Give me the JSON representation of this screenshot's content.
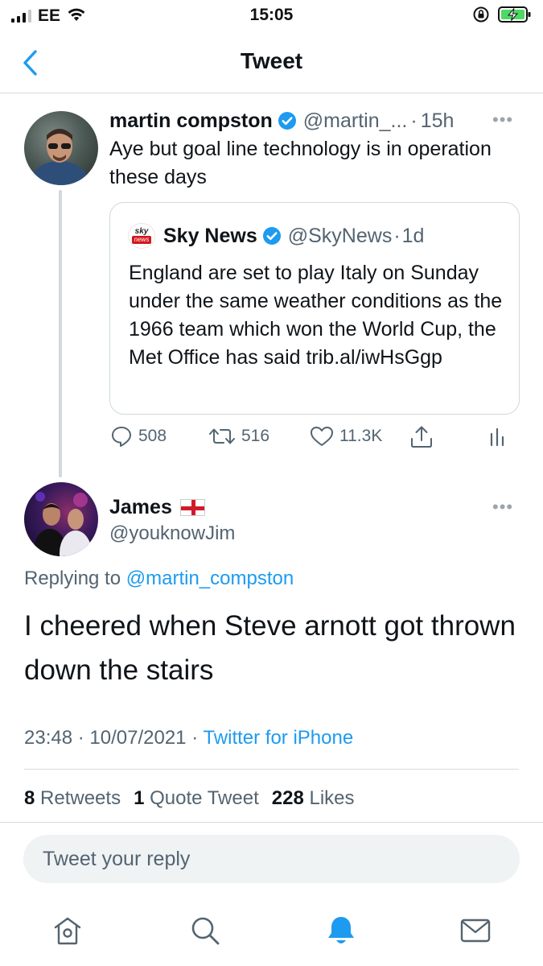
{
  "status_bar": {
    "carrier": "EE",
    "time": "15:05"
  },
  "header": {
    "title": "Tweet"
  },
  "parent_tweet": {
    "name": "martin compston",
    "handle": "@martin_...",
    "separator": "·",
    "time": "15h",
    "text": "Aye but goal line technology is in operation these days",
    "quoted": {
      "name": "Sky News",
      "handle": "@SkyNews",
      "separator": "·",
      "time": "1d",
      "logo_top": "sky",
      "logo_bottom": "news",
      "text": "England are set to play Italy on Sunday under the same weather conditions as the 1966 team which won the World Cup, the Met Office has said trib.al/iwHsGgp"
    },
    "actions": {
      "replies": "508",
      "retweets": "516",
      "likes": "11.3K"
    }
  },
  "reply_tweet": {
    "name": "James",
    "handle": "@youknowJim",
    "replying_prefix": "Replying to",
    "replying_to": "@martin_compston",
    "text": "I cheered when Steve arnott got thrown down the stairs",
    "time": "23:48",
    "meta_sep1": "·",
    "date": "10/07/2021",
    "meta_sep2": "·",
    "source": "Twitter for iPhone",
    "stats": {
      "retweets_count": "8",
      "retweets_label": "Retweets",
      "quotes_count": "1",
      "quotes_label": "Quote Tweet",
      "likes_count": "228",
      "likes_label": "Likes"
    }
  },
  "reply_box": {
    "placeholder": "Tweet your reply"
  },
  "tab_bar": {
    "icons": [
      "home-icon",
      "search-icon",
      "notifications-icon",
      "messages-icon"
    ],
    "active": "notifications-icon"
  },
  "colors": {
    "accent": "#1d9bf0",
    "secondary_text": "#536471",
    "primary_text": "#0f1419",
    "divider": "#d6d9db"
  }
}
